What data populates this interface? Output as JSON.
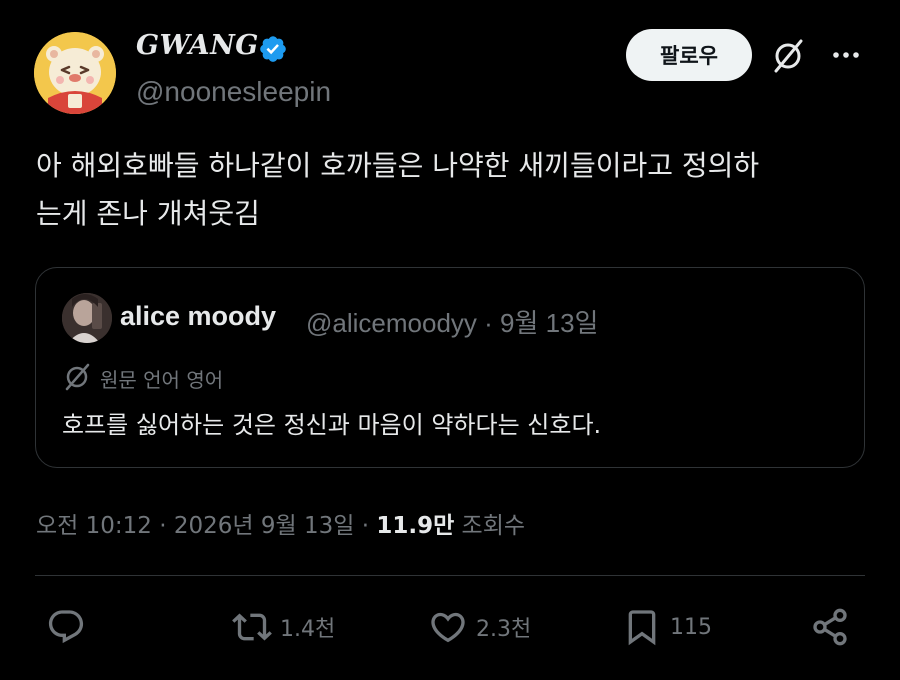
{
  "author": {
    "display_name": "GWANG",
    "handle": "@noonesleepin",
    "verified": true,
    "follow_label": "팔로우"
  },
  "tweet": {
    "text_line1": "아 해외호빠들 하나같이 호까들은 나약한 새끼들이라고 정의하",
    "text_line2": "는게 존나 개쳐웃김"
  },
  "quote": {
    "name": "alice moody",
    "meta": "@alicemoodyy · 9월 13일",
    "language_note": "원문 언어 영어",
    "text": "호프를 싫어하는 것은 정신과 마음이 약하다는 신호다."
  },
  "timestamp": {
    "datetime": "오전 10:12 · 2026년 9월 13일 · ",
    "views_count": "11.9만",
    "views_label": " 조회수"
  },
  "actions": {
    "reply_icon": "reply-icon",
    "retweet_icon": "retweet-icon",
    "retweet_count": "1.4천",
    "like_icon": "heart-icon",
    "like_count": "2.3천",
    "bookmark_icon": "bookmark-icon",
    "bookmark_count": "115",
    "share_icon": "share-icon"
  },
  "colors": {
    "background": "#000000",
    "text_primary": "#e7e9ea",
    "text_secondary": "#71767b",
    "border": "#2f3336",
    "verified_blue": "#1d9bf0",
    "follow_button_bg": "#eff3f4"
  }
}
